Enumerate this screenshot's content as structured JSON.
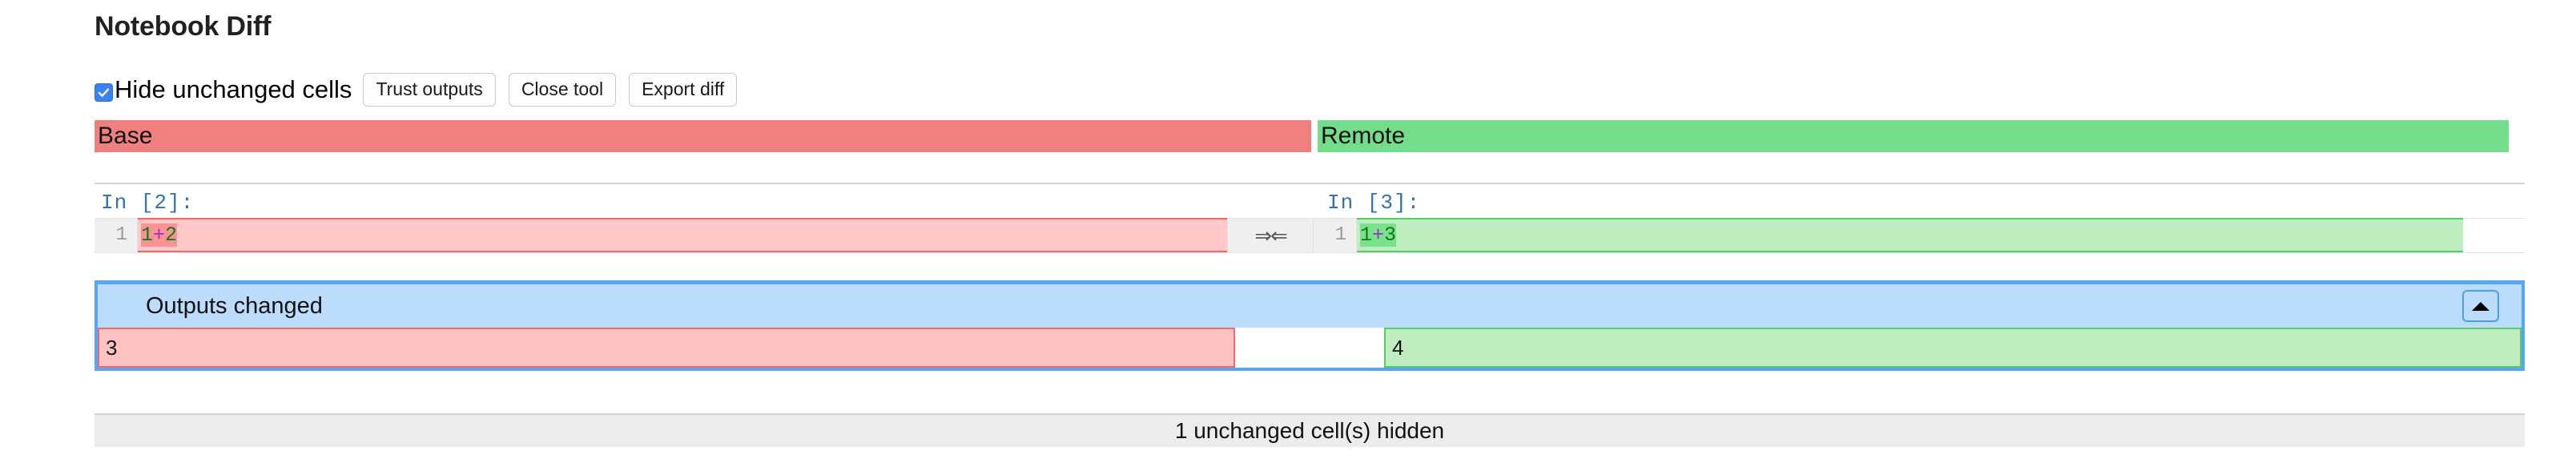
{
  "header": {
    "title": "Notebook Diff"
  },
  "toolbar": {
    "hide_unchanged_label": "Hide unchanged cells",
    "hide_unchanged_checked": true,
    "trust_outputs_label": "Trust outputs",
    "close_tool_label": "Close tool",
    "export_diff_label": "Export diff"
  },
  "panes": {
    "base_label": "Base",
    "remote_label": "Remote"
  },
  "cell": {
    "base_prompt": "In [2]:",
    "remote_prompt": "In [3]:",
    "base_line_number": "1",
    "remote_line_number": "1",
    "base_source_removed": "1+2",
    "remote_source_added": "1+3",
    "merge_arrows": "⇒⇐"
  },
  "outputs": {
    "changed_label": "Outputs changed",
    "collapse_icon": "triangle-up",
    "base_output": "3",
    "remote_output": "4"
  },
  "footer": {
    "hidden_cells_label": "1 unchanged cell(s) hidden"
  },
  "colors": {
    "base_header": "#f08080",
    "remote_header": "#74dd8b",
    "removed_bg": "#ffc9c9",
    "removed_border": "#ef6b6b",
    "removed_highlight": "#fa9393",
    "added_bg": "#bfedbf",
    "added_border": "#55cc69",
    "added_highlight": "#79e38b",
    "output_panel_border": "#55a6f5",
    "output_panel_bg": "#bcdcfc",
    "prompt_text": "#3572b0",
    "checkbox_accent": "#3b82f6",
    "number_token": "#137a13",
    "operator_token": "#9a33c8"
  }
}
